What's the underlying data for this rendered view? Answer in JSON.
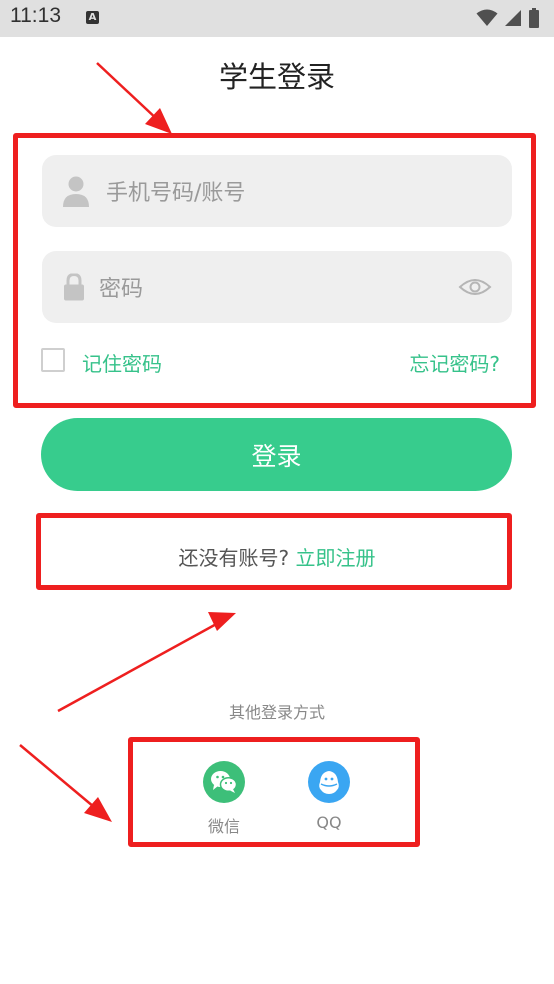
{
  "status_bar": {
    "time": "11:13",
    "indicator": "A"
  },
  "page": {
    "title": "学生登录"
  },
  "form": {
    "account_placeholder": "手机号码/账号",
    "password_placeholder": "密码",
    "remember_label": "记住密码",
    "forgot_label": "忘记密码?",
    "login_label": "登录"
  },
  "register": {
    "prompt": "还没有账号? ",
    "link_label": "立即注册"
  },
  "other_login": {
    "title": "其他登录方式",
    "options": [
      {
        "name": "微信",
        "icon": "wechat-icon",
        "color": "#3dbf79"
      },
      {
        "name": "QQ",
        "icon": "qq-icon",
        "color": "#3aa6f2"
      }
    ]
  },
  "colors": {
    "accent": "#37cc8d",
    "annotation": "#ee1f1f"
  }
}
